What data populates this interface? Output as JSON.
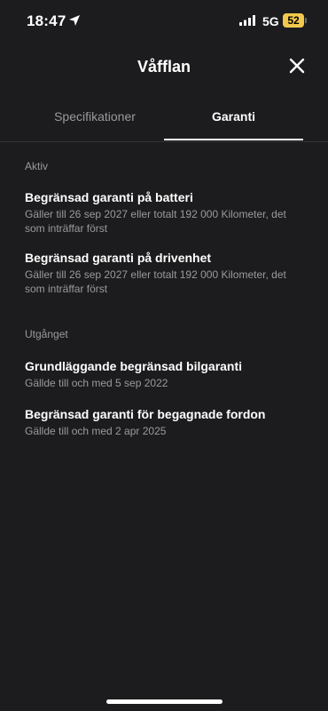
{
  "status_bar": {
    "time": "18:47",
    "network": "5G",
    "battery": "52"
  },
  "header": {
    "title": "Våfflan"
  },
  "tabs": [
    {
      "label": "Specifikationer",
      "active": false
    },
    {
      "label": "Garanti",
      "active": true
    }
  ],
  "sections": {
    "active": {
      "label": "Aktiv",
      "items": [
        {
          "title": "Begränsad garanti på batteri",
          "subtitle": "Gäller till 26 sep 2027 eller totalt 192 000 Kilometer, det som inträffar först"
        },
        {
          "title": "Begränsad garanti på drivenhet",
          "subtitle": "Gäller till 26 sep 2027 eller totalt 192 000 Kilometer, det som inträffar först"
        }
      ]
    },
    "expired": {
      "label": "Utgånget",
      "items": [
        {
          "title": "Grundläggande begränsad bilgaranti",
          "subtitle": "Gällde till och med 5 sep 2022"
        },
        {
          "title": "Begränsad garanti för begagnade fordon",
          "subtitle": "Gällde till och med 2 apr 2025"
        }
      ]
    }
  },
  "icons": {
    "location": "location-arrow-icon",
    "signal": "cellular-signal-icon",
    "close": "close-icon"
  },
  "colors": {
    "background": "#1c1c1e",
    "secondary_text": "#9a9a9e",
    "battery": "#f2c94c"
  }
}
